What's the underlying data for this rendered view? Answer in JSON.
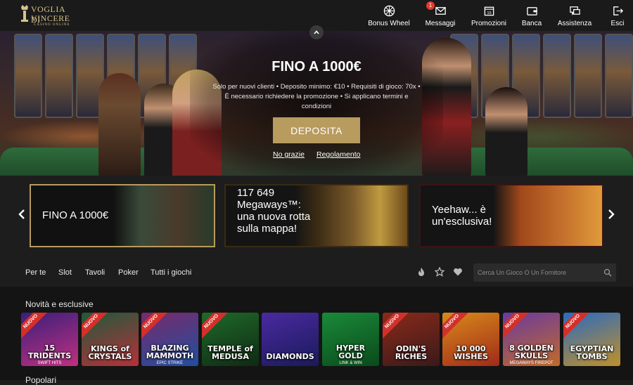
{
  "logo": {
    "line1": "VOGLIA DI",
    "line2": "VINCERE",
    "line3": "CASINO ONLINE"
  },
  "nav": [
    {
      "label": "Bonus Wheel",
      "icon": "wheel-icon"
    },
    {
      "label": "Messaggi",
      "icon": "envelope-icon",
      "badge": "1"
    },
    {
      "label": "Promozioni",
      "icon": "calendar-icon",
      "icon_text": "15"
    },
    {
      "label": "Banca",
      "icon": "wallet-icon"
    },
    {
      "label": "Assistenza",
      "icon": "chat-icon"
    },
    {
      "label": "Esci",
      "icon": "logout-icon"
    }
  ],
  "hero": {
    "title": "FINO A 1000€",
    "text": "Solo per nuovi clienti • Deposito minimo: €10 • Requisiti di gioco: 70x • È necessario richiedere la promozione • Si applicano termini e condizioni",
    "cta": "DEPOSITA",
    "link_no": "No grazie",
    "link_rules": "Regolamento"
  },
  "promo_cards": [
    {
      "text": "FINO A 1000€"
    },
    {
      "text": "117 649 Megaways™: una nuova rotta sulla mappa!"
    },
    {
      "text": "Yeehaw... è un'esclusiva!"
    }
  ],
  "filters": [
    "Per te",
    "Slot",
    "Tavoli",
    "Poker",
    "Tutti i giochi"
  ],
  "search": {
    "placeholder": "Cerca Un Gioco O Un Fornitore"
  },
  "sections": {
    "new": "Novità e esclusive",
    "popular": "Popolari"
  },
  "ribbon_label": "NUOVO",
  "games": [
    {
      "name": "15 TRIDENTS",
      "sub": "SWIFT HITS",
      "new": true,
      "bg": "#3a1f7a",
      "bg2": "#c03080"
    },
    {
      "name": "KINGS of CRYSTALS",
      "sub": "",
      "new": true,
      "bg": "#1f5a3a",
      "bg2": "#b8303a"
    },
    {
      "name": "BLAZING MAMMOTH",
      "sub": "EPIC STRIKE",
      "new": true,
      "bg": "#7a2a6a",
      "bg2": "#1f4fa0"
    },
    {
      "name": "TEMPLE of MEDUSA",
      "sub": "",
      "new": true,
      "bg": "#1f6a2a",
      "bg2": "#0f2a14"
    },
    {
      "name": "DIAMONDS",
      "sub": "",
      "new": false,
      "bg": "#4a2aa0",
      "bg2": "#1a1a5a"
    },
    {
      "name": "HYPER GOLD",
      "sub": "LINK & WIN",
      "new": false,
      "bg": "#1a8a3a",
      "bg2": "#0a4a1a"
    },
    {
      "name": "ODIN'S RICHES",
      "sub": "",
      "new": true,
      "bg": "#8a2a1a",
      "bg2": "#3a1a1a"
    },
    {
      "name": "10 000 WISHES",
      "sub": "",
      "new": true,
      "bg": "#d88a1a",
      "bg2": "#a02a1a"
    },
    {
      "name": "8 GOLDEN SKULLS",
      "sub": "MEGAWAYS FIREPOT",
      "new": true,
      "bg": "#6a3aa0",
      "bg2": "#c06a2a"
    },
    {
      "name": "EGYPTIAN TOMBS",
      "sub": "",
      "new": true,
      "bg": "#2a6ac0",
      "bg2": "#c0902a"
    }
  ],
  "colors": {
    "gold": "#b89b5e",
    "badge": "#e03a2f",
    "ribbon": "#d4302b"
  }
}
